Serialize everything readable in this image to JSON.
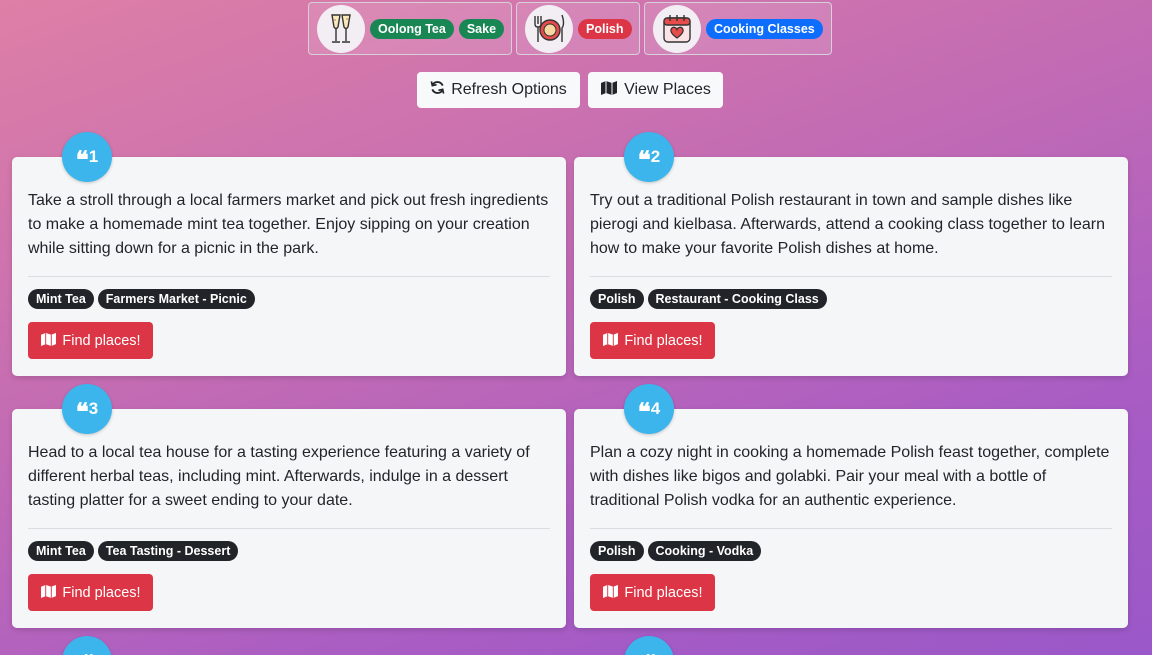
{
  "chips": [
    {
      "icon": "champagne-glasses-icon",
      "labels": [
        "Oolong Tea",
        "Sake"
      ],
      "color": "green"
    },
    {
      "icon": "plate-fork-knife-icon",
      "labels": [
        "Polish"
      ],
      "color": "red"
    },
    {
      "icon": "calendar-heart-icon",
      "labels": [
        "Cooking Classes"
      ],
      "color": "blue"
    }
  ],
  "actions": {
    "refresh_label": "Refresh Options",
    "view_label": "View Places"
  },
  "cards": [
    {
      "number": "1",
      "text": "Take a stroll through a local farmers market and pick out fresh ingredients to make a homemade mint tea together. Enjoy sipping on your creation while sitting down for a picnic in the park.",
      "tags": [
        "Mint Tea",
        "Farmers Market - Picnic"
      ],
      "button": "Find places!"
    },
    {
      "number": "2",
      "text": "Try out a traditional Polish restaurant in town and sample dishes like pierogi and kielbasa. Afterwards, attend a cooking class together to learn how to make your favorite Polish dishes at home.",
      "tags": [
        "Polish",
        "Restaurant - Cooking Class"
      ],
      "button": "Find places!"
    },
    {
      "number": "3",
      "text": "Head to a local tea house for a tasting experience featuring a variety of different herbal teas, including mint. Afterwards, indulge in a dessert tasting platter for a sweet ending to your date.",
      "tags": [
        "Mint Tea",
        "Tea Tasting - Dessert"
      ],
      "button": "Find places!"
    },
    {
      "number": "4",
      "text": "Plan a cozy night in cooking a homemade Polish feast together, complete with dishes like bigos and golabki. Pair your meal with a bottle of traditional Polish vodka for an authentic experience.",
      "tags": [
        "Polish",
        "Cooking - Vodka"
      ],
      "button": "Find places!"
    }
  ],
  "colors": {
    "badge": "#3cb4ec",
    "find_button": "#dc3545",
    "tag": "#212529",
    "pill_green": "#198754",
    "pill_red": "#dc3545",
    "pill_blue": "#0d6efd"
  }
}
